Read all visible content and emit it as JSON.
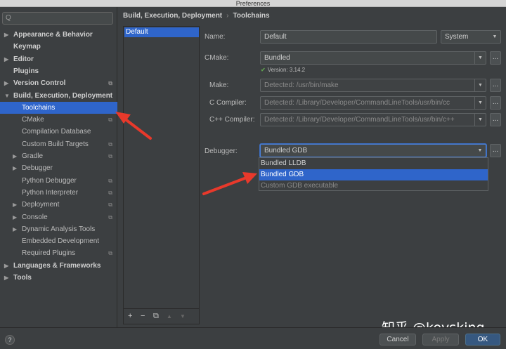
{
  "window": {
    "title": "Preferences"
  },
  "search": {
    "placeholder": "Q"
  },
  "sidebar": {
    "items": [
      {
        "label": "Appearance & Behavior",
        "bold": true,
        "arrow": "right",
        "depth": 0
      },
      {
        "label": "Keymap",
        "bold": true,
        "arrow": "",
        "depth": 0
      },
      {
        "label": "Editor",
        "bold": true,
        "arrow": "right",
        "depth": 0
      },
      {
        "label": "Plugins",
        "bold": true,
        "arrow": "",
        "depth": 0
      },
      {
        "label": "Version Control",
        "bold": true,
        "arrow": "right",
        "depth": 0,
        "project": true
      },
      {
        "label": "Build, Execution, Deployment",
        "bold": true,
        "arrow": "down",
        "depth": 0
      },
      {
        "label": "Toolchains",
        "bold": false,
        "arrow": "",
        "depth": 1,
        "selected": true
      },
      {
        "label": "CMake",
        "bold": false,
        "arrow": "",
        "depth": 1,
        "project": true
      },
      {
        "label": "Compilation Database",
        "bold": false,
        "arrow": "",
        "depth": 1
      },
      {
        "label": "Custom Build Targets",
        "bold": false,
        "arrow": "",
        "depth": 1,
        "project": true
      },
      {
        "label": "Gradle",
        "bold": false,
        "arrow": "right",
        "depth": 1,
        "project": true
      },
      {
        "label": "Debugger",
        "bold": false,
        "arrow": "right",
        "depth": 1
      },
      {
        "label": "Python Debugger",
        "bold": false,
        "arrow": "",
        "depth": 1,
        "project": true
      },
      {
        "label": "Python Interpreter",
        "bold": false,
        "arrow": "",
        "depth": 1,
        "project": true
      },
      {
        "label": "Deployment",
        "bold": false,
        "arrow": "right",
        "depth": 1,
        "project": true
      },
      {
        "label": "Console",
        "bold": false,
        "arrow": "right",
        "depth": 1,
        "project": true
      },
      {
        "label": "Dynamic Analysis Tools",
        "bold": false,
        "arrow": "right",
        "depth": 1
      },
      {
        "label": "Embedded Development",
        "bold": false,
        "arrow": "",
        "depth": 1
      },
      {
        "label": "Required Plugins",
        "bold": false,
        "arrow": "",
        "depth": 1,
        "project": true
      },
      {
        "label": "Languages & Frameworks",
        "bold": true,
        "arrow": "right",
        "depth": 0
      },
      {
        "label": "Tools",
        "bold": true,
        "arrow": "right",
        "depth": 0
      }
    ]
  },
  "breadcrumb": {
    "parent": "Build, Execution, Deployment",
    "separator": "›",
    "current": "Toolchains"
  },
  "toolchains_list": {
    "items": [
      "Default"
    ],
    "tools": {
      "add": "+",
      "remove": "−",
      "copy": "⧉",
      "up": "▲",
      "down": "▼"
    }
  },
  "form": {
    "name_label": "Name:",
    "name_value": "Default",
    "system_value": "System",
    "cmake_label": "CMake:",
    "cmake_value": "Bundled",
    "cmake_version": "Version: 3.14.2",
    "make_label": "Make:",
    "make_value": "Detected: /usr/bin/make",
    "c_label": "C Compiler:",
    "c_value": "Detected: /Library/Developer/CommandLineTools/usr/bin/cc",
    "cpp_label": "C++ Compiler:",
    "cpp_value": "Detected: /Library/Developer/CommandLineTools/usr/bin/c++",
    "debugger_label": "Debugger:",
    "debugger_value": "Bundled GDB",
    "browse": "..."
  },
  "debugger_popup": {
    "options": [
      "Bundled LLDB",
      "Bundled GDB",
      "Custom GDB executable"
    ],
    "selected": "Bundled GDB"
  },
  "footer": {
    "help": "?",
    "cancel": "Cancel",
    "apply": "Apply",
    "ok": "OK"
  },
  "watermark": "知乎 @keysking",
  "colors": {
    "selection": "#2f65ca",
    "annotation_arrow": "#e8392b",
    "check": "#5fa14f"
  }
}
